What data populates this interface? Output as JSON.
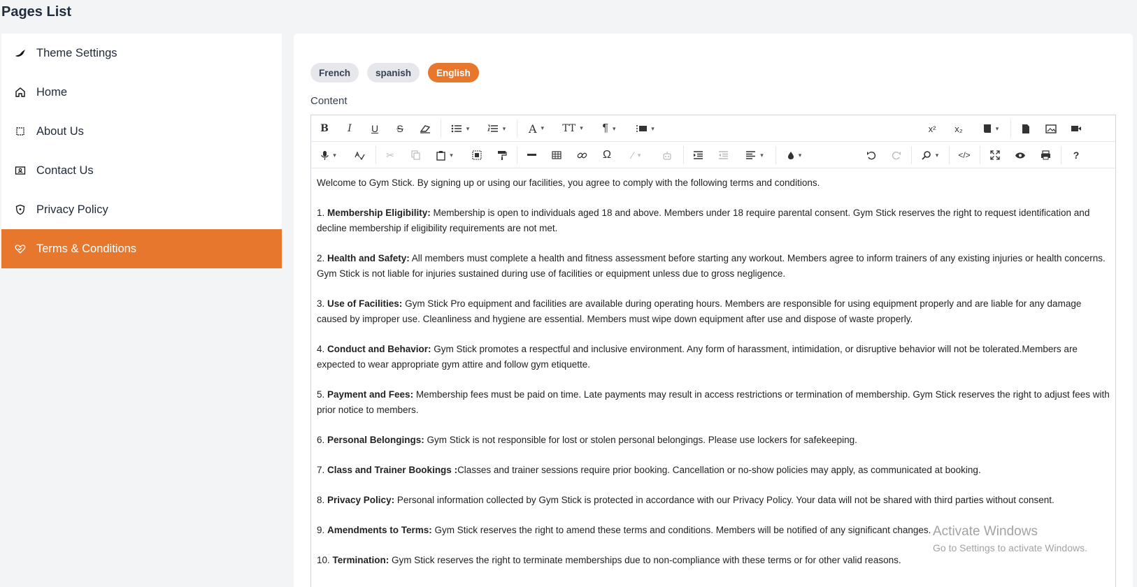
{
  "page_title": "Pages List",
  "sidebar": {
    "items": [
      {
        "label": "Theme Settings",
        "icon": "brush-icon",
        "active": false
      },
      {
        "label": "Home",
        "icon": "home-icon",
        "active": false
      },
      {
        "label": "About Us",
        "icon": "square-icon",
        "active": false
      },
      {
        "label": "Contact Us",
        "icon": "contact-card-icon",
        "active": false
      },
      {
        "label": "Privacy Policy",
        "icon": "shield-icon",
        "active": false
      },
      {
        "label": "Terms & Conditions",
        "icon": "heart-handshake-icon",
        "active": true
      }
    ]
  },
  "languages": {
    "tabs": [
      {
        "label": "French",
        "active": false
      },
      {
        "label": "spanish",
        "active": false
      },
      {
        "label": "English",
        "active": true
      }
    ]
  },
  "content_label": "Content",
  "colors": {
    "accent": "#e8772e"
  },
  "toolbar": {
    "font_icon_label": "A",
    "font_size_label": "TT",
    "superscript_label": "x²",
    "subscript_label": "x₂",
    "omega_label": "Ω",
    "help_label": "?"
  },
  "editor": {
    "intro": "Welcome to Gym Stick. By signing up or using our facilities, you agree to comply with the following terms and conditions.",
    "sections": [
      {
        "num": "1. ",
        "title": "Membership Eligibility:",
        "text": " Membership is open to individuals aged 18 and above. Members under 18 require parental consent. Gym Stick  reserves the right to request identification and decline membership if eligibility requirements are not met."
      },
      {
        "num": "2. ",
        "title": "Health and Safety:",
        "text": " All members must complete a health and fitness assessment before starting any workout. Members agree to inform trainers of any existing injuries or health concerns. Gym Stick  is not liable for injuries sustained during use of facilities or equipment unless due to gross negligence."
      },
      {
        "num": "3. ",
        "title": "Use of Facilities:",
        "text": " Gym Stick Pro equipment and facilities are available during operating hours. Members are responsible for using equipment properly and are liable for any damage caused by improper use. Cleanliness and hygiene are essential. Members must wipe down equipment after use and dispose of waste properly."
      },
      {
        "num": "4. ",
        "title": "Conduct and Behavior:",
        "text": " Gym Stick promotes a respectful and inclusive environment. Any form of harassment, intimidation, or disruptive behavior will not be tolerated.Members are expected to wear appropriate gym attire and follow gym etiquette."
      },
      {
        "num": "5. ",
        "title": "Payment and Fees:",
        "text": " Membership fees must be paid on time. Late payments may result in access restrictions or termination of membership. Gym Stick reserves the right to adjust fees with prior notice to members."
      },
      {
        "num": "6. ",
        "title": "Personal Belongings:",
        "text": " Gym Stick is not responsible for lost or stolen personal belongings. Please use lockers for safekeeping."
      },
      {
        "num": "7. ",
        "title": "Class and Trainer Bookings :",
        "text": "Classes and trainer sessions require prior booking. Cancellation or no-show policies may apply, as communicated at booking."
      },
      {
        "num": "8. ",
        "title": "Privacy Policy:",
        "text": " Personal information collected by Gym Stick is protected in accordance with our Privacy Policy. Your data will not be shared with third parties without consent."
      },
      {
        "num": "9. ",
        "title": "Amendments to Terms:",
        "text": " Gym Stick reserves the right to amend these terms and conditions. Members will be notified of any significant changes."
      },
      {
        "num": "10. ",
        "title": "Termination:",
        "text": " Gym Stick reserves the right to terminate memberships due to non-compliance with these terms or for other valid reasons."
      }
    ]
  },
  "watermark": {
    "line1": "Activate Windows",
    "line2": "Go to Settings to activate Windows."
  }
}
